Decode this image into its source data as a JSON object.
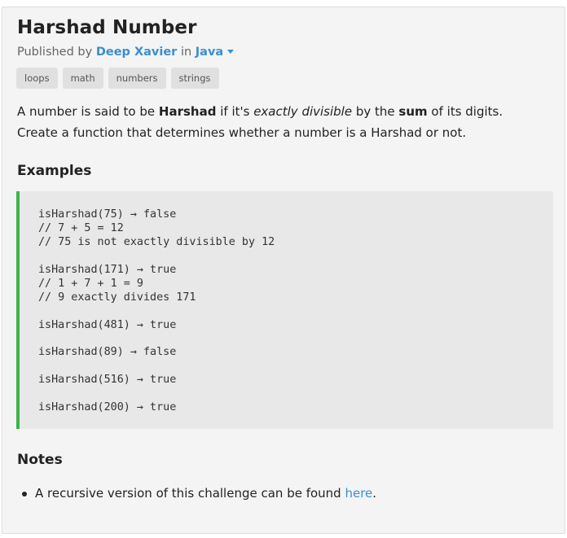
{
  "challenge": {
    "title": "Harshad Number",
    "published_by_label": "Published by",
    "author": "Deep Xavier",
    "in_label": "in",
    "language": "Java",
    "tags": [
      "loops",
      "math",
      "numbers",
      "strings"
    ]
  },
  "description": {
    "p1": "A number is said to be ",
    "term": "Harshad",
    "p2": " if it's ",
    "emph": "exactly divisible",
    "p3": " by the ",
    "sum": "sum",
    "p4": " of its digits. Create a function that determines whether a number is a Harshad or not."
  },
  "examples": {
    "heading": "Examples",
    "blocks": [
      [
        "isHarshad(75) → false",
        "// 7 + 5 = 12",
        "// 75 is not exactly divisible by 12"
      ],
      [
        "isHarshad(171) → true",
        "// 1 + 7 + 1 = 9",
        "// 9 exactly divides 171"
      ],
      [
        "isHarshad(481) → true"
      ],
      [
        "isHarshad(89) → false"
      ],
      [
        "isHarshad(516) → true"
      ],
      [
        "isHarshad(200) → true"
      ]
    ]
  },
  "notes": {
    "heading": "Notes",
    "item_text": "A recursive version of this challenge can be found ",
    "item_link": "here",
    "item_end": "."
  },
  "colors": {
    "link": "#3a8fd0",
    "code_border": "#3bb44a",
    "card_bg": "#f4f4f4",
    "code_bg": "#e8e8e8"
  }
}
